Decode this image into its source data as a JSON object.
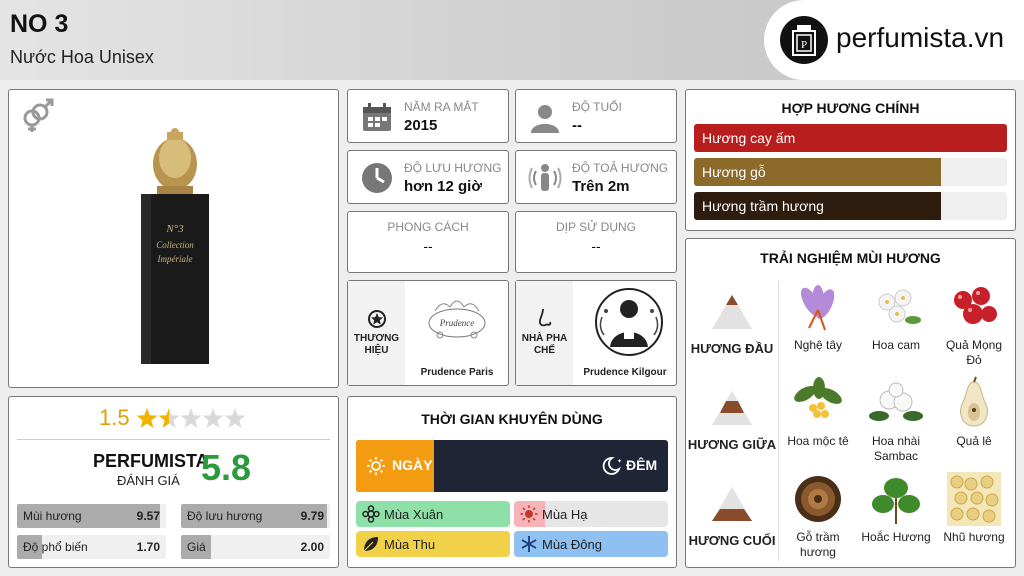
{
  "header": {
    "title": "NO 3",
    "subtitle": "Nước Hoa Unisex",
    "logo_text": "perfumista.vn"
  },
  "product": {
    "bottle_line1": "N°3",
    "bottle_line2": "Collection",
    "bottle_line3": "Impériale"
  },
  "stats": {
    "year": {
      "label": "NĂM RA MẮT",
      "value": "2015"
    },
    "age": {
      "label": "ĐỘ TUỔI",
      "value": "--"
    },
    "longevity": {
      "label": "ĐỘ LƯU HƯƠNG",
      "value": "hơn 12 giờ"
    },
    "sillage": {
      "label": "ĐỘ TOẢ HƯƠNG",
      "value": "Trên 2m"
    },
    "style": {
      "label": "PHONG CÁCH",
      "value": "--"
    },
    "occasion": {
      "label": "DỊP SỬ DỤNG",
      "value": "--"
    },
    "brand": {
      "label_line1": "THƯƠNG",
      "label_line2": "HIỆU",
      "name": "Prudence Paris",
      "logo_text": "Prudence"
    },
    "perfumer": {
      "label_line1": "NHÀ PHA",
      "label_line2": "CHẾ",
      "name": "Prudence Kilgour"
    }
  },
  "rating": {
    "stars_value": "1.5",
    "stars_fraction": 0.3,
    "brand_label": "PERFUMISTA",
    "eval_label": "ĐÁNH GIÁ",
    "score": "5.8",
    "scores": [
      {
        "label": "Mùi hương",
        "value": "9.57",
        "fraction": 0.957
      },
      {
        "label": "Độ lưu hương",
        "value": "9.79",
        "fraction": 0.979
      },
      {
        "label": "Độ phổ biến",
        "value": "1.70",
        "fraction": 0.17
      },
      {
        "label": "Giá",
        "value": "2.00",
        "fraction": 0.2
      }
    ]
  },
  "time": {
    "title": "THỜI GIAN KHUYÊN DÙNG",
    "day_label": "NGÀY",
    "night_label": "ĐÊM",
    "day_fraction": 0.25,
    "seasons": [
      {
        "label": "Mùa Xuân",
        "fraction": 1.0,
        "color": "#8fe0a8"
      },
      {
        "label": "Mùa Hạ",
        "fraction": 0.2,
        "color": "#f7b3b8"
      },
      {
        "label": "Mùa Thu",
        "fraction": 1.0,
        "color": "#f2d14a"
      },
      {
        "label": "Mùa Đông",
        "fraction": 1.0,
        "color": "#8fc0f2"
      }
    ]
  },
  "accords": {
    "title": "HỢP HƯƠNG CHÍNH",
    "items": [
      {
        "label": "Hương cay ấm",
        "fraction": 1.0,
        "color": "#b81e1e"
      },
      {
        "label": "Hương gỗ",
        "fraction": 0.79,
        "color": "#8b6a2a"
      },
      {
        "label": "Hương trầm hương",
        "fraction": 0.79,
        "color": "#2e1d0f"
      }
    ]
  },
  "notes": {
    "title": "TRẢI NGHIỆM MÙI HƯƠNG",
    "top_label": "HƯƠNG ĐẦU",
    "middle_label": "HƯƠNG GIỮA",
    "base_label": "HƯƠNG CUỐI",
    "top": [
      "Nghệ tây",
      "Hoa cam",
      "Quả Mọng Đỏ"
    ],
    "middle": [
      "Hoa mộc tê",
      "Hoa nhài Sambac",
      "Quả lê"
    ],
    "base": [
      "Gỗ trầm hương",
      "Hoắc Hương",
      "Nhũ hương"
    ]
  }
}
